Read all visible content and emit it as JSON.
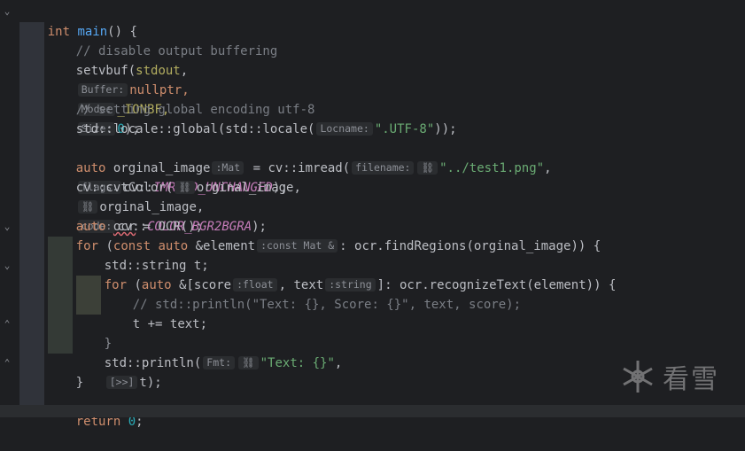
{
  "code": {
    "l1_kw": "int",
    "l1_fn": "main",
    "l1_rest": "() {",
    "l2": "// disable output buffering",
    "l3_a": "setvbuf(",
    "l3_b": "stdout",
    "l3_c": ",",
    "l3_h1": "Buffer:",
    "l3_d": "nullptr,",
    "l3_h2": "Mode:",
    "l3_e": "_IONBF,",
    "l3_h3": "Size:",
    "l3_f": "0",
    "l3_g": ");",
    "l5": "// setting global encoding utf-8",
    "l6_a": "std::locale::global(std::locale(",
    "l6_h": "Locname:",
    "l6_s": "\".UTF-8\"",
    "l6_b": "));",
    "l8_kw": "auto",
    "l8_a": "orginal_image",
    "l8_h": ":Mat",
    "l8_b": "= cv::imread(",
    "l8_h2": "filename:",
    "l8_s": "\"../test1.png\"",
    "l8_c": ",",
    "l8_h3": "flags:",
    "l8_d": "cv::",
    "l8_e": "IMREAD_UNCHANGED",
    "l8_f": ");",
    "l9_a": "cv::cvtColor(",
    "l9_b": "orginal_image,",
    "l9_c": "orginal_image,",
    "l9_h": "code:",
    "l9_d": "cv::",
    "l9_e": "COLOR_BGR2BGRA",
    "l9_f": ");",
    "l11_kw": "auto",
    "l11_a": "ocr",
    "l11_b": "= OCR();",
    "l12_kw": "for",
    "l12_a": "(",
    "l12_kw2": "const auto",
    "l12_b": "&element",
    "l12_h": ":const Mat &",
    "l12_c": ": ocr.findRegions(orginal_image)) {",
    "l13": "std::string t;",
    "l14_kw": "for",
    "l14_a": "(",
    "l14_kw2": "auto",
    "l14_b": "&[score",
    "l14_h": ":float",
    "l14_c": ", text",
    "l14_h2": ":string",
    "l14_d": "]: ocr.recognizeText(element)) {",
    "l15": "// std::println(\"Text: {}, Score: {}\", text, score);",
    "l16_a": "t",
    "l16_b": "+=",
    "l16_c": "text;",
    "l17": "}",
    "l18_a": "std::println(",
    "l18_h": "Fmt:",
    "l18_s": "\"Text: {}\"",
    "l18_b": ",",
    "l18_h2": "[>>]",
    "l18_c": "t);",
    "l19": "}",
    "l21_kw": "return",
    "l21_n": "0",
    "l21_e": ";"
  },
  "watermark": "看雪",
  "colors": {
    "background": "#1e1f22",
    "keyword": "#cf8e6d",
    "function": "#56a8f5",
    "comment": "#7a7e85",
    "string": "#6aab73",
    "number": "#2aacb8",
    "constant": "#c77dbb"
  },
  "icons": {
    "fold": "chevron-down-icon",
    "fold_end": "chevron-up-icon",
    "hint_link": "link-icon",
    "watermark": "snowflake-icon"
  }
}
